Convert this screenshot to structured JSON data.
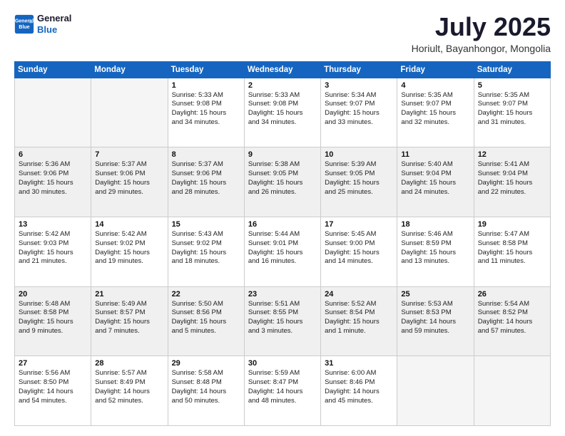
{
  "logo": {
    "line1": "General",
    "line2": "Blue"
  },
  "title": "July 2025",
  "subtitle": "Horiult, Bayanhongor, Mongolia",
  "days_of_week": [
    "Sunday",
    "Monday",
    "Tuesday",
    "Wednesday",
    "Thursday",
    "Friday",
    "Saturday"
  ],
  "weeks": [
    [
      {
        "day": "",
        "empty": true
      },
      {
        "day": "",
        "empty": true
      },
      {
        "day": "1",
        "l1": "Sunrise: 5:33 AM",
        "l2": "Sunset: 9:08 PM",
        "l3": "Daylight: 15 hours",
        "l4": "and 34 minutes."
      },
      {
        "day": "2",
        "l1": "Sunrise: 5:33 AM",
        "l2": "Sunset: 9:08 PM",
        "l3": "Daylight: 15 hours",
        "l4": "and 34 minutes."
      },
      {
        "day": "3",
        "l1": "Sunrise: 5:34 AM",
        "l2": "Sunset: 9:07 PM",
        "l3": "Daylight: 15 hours",
        "l4": "and 33 minutes."
      },
      {
        "day": "4",
        "l1": "Sunrise: 5:35 AM",
        "l2": "Sunset: 9:07 PM",
        "l3": "Daylight: 15 hours",
        "l4": "and 32 minutes."
      },
      {
        "day": "5",
        "l1": "Sunrise: 5:35 AM",
        "l2": "Sunset: 9:07 PM",
        "l3": "Daylight: 15 hours",
        "l4": "and 31 minutes."
      }
    ],
    [
      {
        "day": "6",
        "l1": "Sunrise: 5:36 AM",
        "l2": "Sunset: 9:06 PM",
        "l3": "Daylight: 15 hours",
        "l4": "and 30 minutes."
      },
      {
        "day": "7",
        "l1": "Sunrise: 5:37 AM",
        "l2": "Sunset: 9:06 PM",
        "l3": "Daylight: 15 hours",
        "l4": "and 29 minutes."
      },
      {
        "day": "8",
        "l1": "Sunrise: 5:37 AM",
        "l2": "Sunset: 9:06 PM",
        "l3": "Daylight: 15 hours",
        "l4": "and 28 minutes."
      },
      {
        "day": "9",
        "l1": "Sunrise: 5:38 AM",
        "l2": "Sunset: 9:05 PM",
        "l3": "Daylight: 15 hours",
        "l4": "and 26 minutes."
      },
      {
        "day": "10",
        "l1": "Sunrise: 5:39 AM",
        "l2": "Sunset: 9:05 PM",
        "l3": "Daylight: 15 hours",
        "l4": "and 25 minutes."
      },
      {
        "day": "11",
        "l1": "Sunrise: 5:40 AM",
        "l2": "Sunset: 9:04 PM",
        "l3": "Daylight: 15 hours",
        "l4": "and 24 minutes."
      },
      {
        "day": "12",
        "l1": "Sunrise: 5:41 AM",
        "l2": "Sunset: 9:04 PM",
        "l3": "Daylight: 15 hours",
        "l4": "and 22 minutes."
      }
    ],
    [
      {
        "day": "13",
        "l1": "Sunrise: 5:42 AM",
        "l2": "Sunset: 9:03 PM",
        "l3": "Daylight: 15 hours",
        "l4": "and 21 minutes."
      },
      {
        "day": "14",
        "l1": "Sunrise: 5:42 AM",
        "l2": "Sunset: 9:02 PM",
        "l3": "Daylight: 15 hours",
        "l4": "and 19 minutes."
      },
      {
        "day": "15",
        "l1": "Sunrise: 5:43 AM",
        "l2": "Sunset: 9:02 PM",
        "l3": "Daylight: 15 hours",
        "l4": "and 18 minutes."
      },
      {
        "day": "16",
        "l1": "Sunrise: 5:44 AM",
        "l2": "Sunset: 9:01 PM",
        "l3": "Daylight: 15 hours",
        "l4": "and 16 minutes."
      },
      {
        "day": "17",
        "l1": "Sunrise: 5:45 AM",
        "l2": "Sunset: 9:00 PM",
        "l3": "Daylight: 15 hours",
        "l4": "and 14 minutes."
      },
      {
        "day": "18",
        "l1": "Sunrise: 5:46 AM",
        "l2": "Sunset: 8:59 PM",
        "l3": "Daylight: 15 hours",
        "l4": "and 13 minutes."
      },
      {
        "day": "19",
        "l1": "Sunrise: 5:47 AM",
        "l2": "Sunset: 8:58 PM",
        "l3": "Daylight: 15 hours",
        "l4": "and 11 minutes."
      }
    ],
    [
      {
        "day": "20",
        "l1": "Sunrise: 5:48 AM",
        "l2": "Sunset: 8:58 PM",
        "l3": "Daylight: 15 hours",
        "l4": "and 9 minutes."
      },
      {
        "day": "21",
        "l1": "Sunrise: 5:49 AM",
        "l2": "Sunset: 8:57 PM",
        "l3": "Daylight: 15 hours",
        "l4": "and 7 minutes."
      },
      {
        "day": "22",
        "l1": "Sunrise: 5:50 AM",
        "l2": "Sunset: 8:56 PM",
        "l3": "Daylight: 15 hours",
        "l4": "and 5 minutes."
      },
      {
        "day": "23",
        "l1": "Sunrise: 5:51 AM",
        "l2": "Sunset: 8:55 PM",
        "l3": "Daylight: 15 hours",
        "l4": "and 3 minutes."
      },
      {
        "day": "24",
        "l1": "Sunrise: 5:52 AM",
        "l2": "Sunset: 8:54 PM",
        "l3": "Daylight: 15 hours",
        "l4": "and 1 minute."
      },
      {
        "day": "25",
        "l1": "Sunrise: 5:53 AM",
        "l2": "Sunset: 8:53 PM",
        "l3": "Daylight: 14 hours",
        "l4": "and 59 minutes."
      },
      {
        "day": "26",
        "l1": "Sunrise: 5:54 AM",
        "l2": "Sunset: 8:52 PM",
        "l3": "Daylight: 14 hours",
        "l4": "and 57 minutes."
      }
    ],
    [
      {
        "day": "27",
        "l1": "Sunrise: 5:56 AM",
        "l2": "Sunset: 8:50 PM",
        "l3": "Daylight: 14 hours",
        "l4": "and 54 minutes."
      },
      {
        "day": "28",
        "l1": "Sunrise: 5:57 AM",
        "l2": "Sunset: 8:49 PM",
        "l3": "Daylight: 14 hours",
        "l4": "and 52 minutes."
      },
      {
        "day": "29",
        "l1": "Sunrise: 5:58 AM",
        "l2": "Sunset: 8:48 PM",
        "l3": "Daylight: 14 hours",
        "l4": "and 50 minutes."
      },
      {
        "day": "30",
        "l1": "Sunrise: 5:59 AM",
        "l2": "Sunset: 8:47 PM",
        "l3": "Daylight: 14 hours",
        "l4": "and 48 minutes."
      },
      {
        "day": "31",
        "l1": "Sunrise: 6:00 AM",
        "l2": "Sunset: 8:46 PM",
        "l3": "Daylight: 14 hours",
        "l4": "and 45 minutes."
      },
      {
        "day": "",
        "empty": true
      },
      {
        "day": "",
        "empty": true
      }
    ]
  ]
}
